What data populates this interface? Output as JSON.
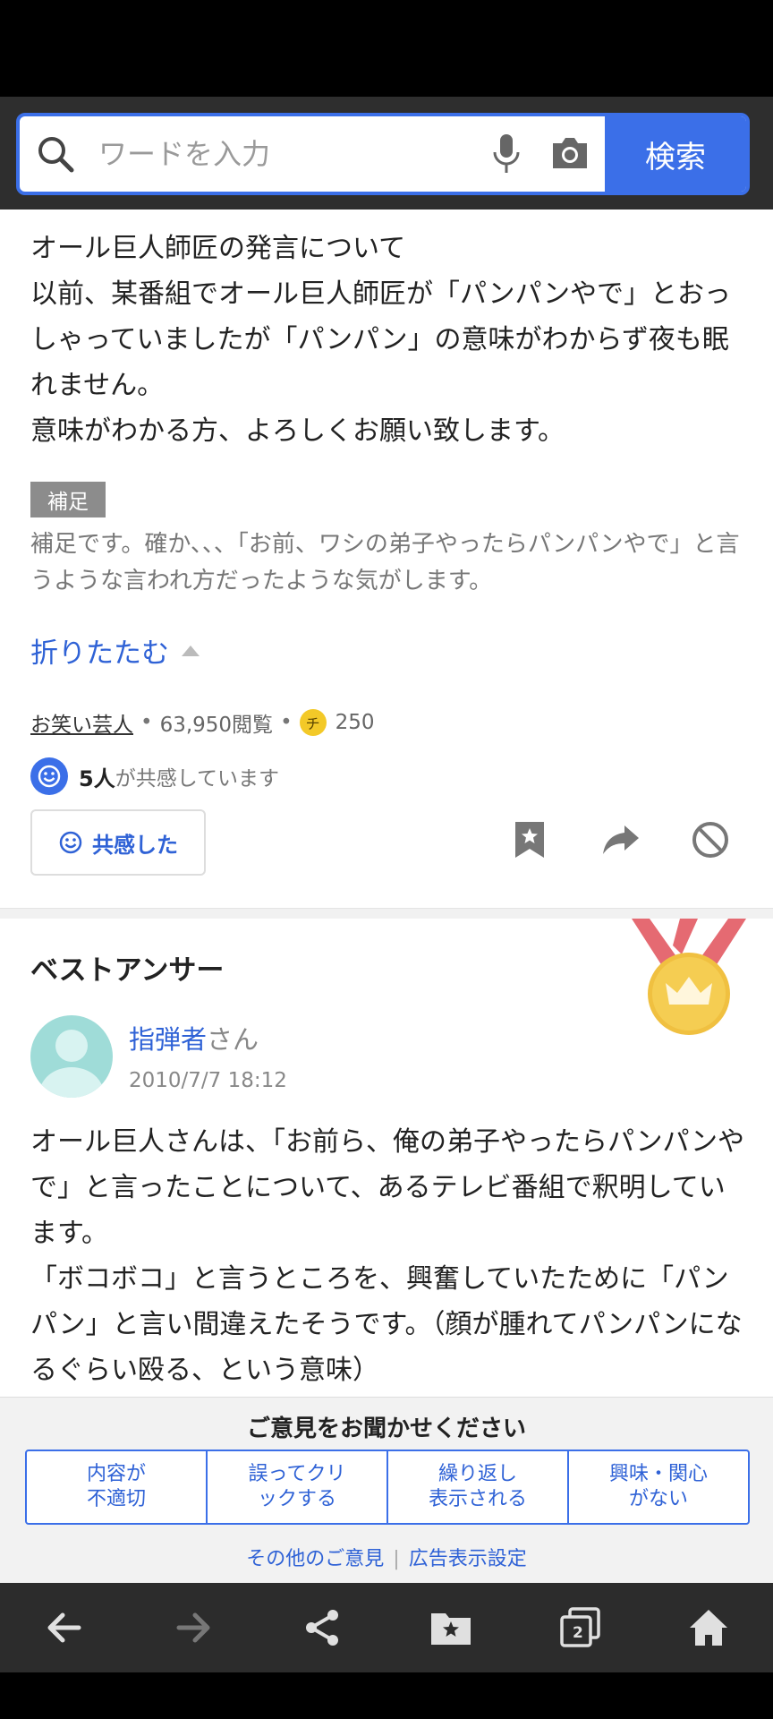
{
  "search": {
    "placeholder": "ワードを入力",
    "button_label": "検索"
  },
  "question": {
    "text": "オール巨人師匠の発言について\n以前、某番組でオール巨人師匠が「パンパンやで」とおっしゃっていましたが「パンパン」の意味がわからず夜も眠れません。\n意味がわかる方、よろしくお願い致します。",
    "supplement_badge": "補足",
    "supplement_text": "補足です。確か、、、「お前、ワシの弟子やったらパンパンやで」と言うような言われ方だったような気がします。",
    "fold_label": "折りたたむ",
    "category": "お笑い芸人",
    "views": "63,950閲覧",
    "coin_label": "チ",
    "coins": "250",
    "empathy_count": "5人",
    "empathy_suffix": "が共感しています",
    "empathy_button": "共感した"
  },
  "best_answer": {
    "title": "ベストアンサー",
    "answerer_name": "指弾者",
    "answerer_suffix": "さん",
    "date": "2010/7/7 18:12",
    "text": "オール巨人さんは、「お前ら、俺の弟子やったらパンパンやで」と言ったことについて、あるテレビ番組で釈明しています。\n「ボコボコ」と言うところを、興奮していたために「パンパン」と言い間違えたそうです。（顔が腫れてパンパンになるぐらい殴る、という意味）"
  },
  "feedback": {
    "title": "ご意見をお聞かせください",
    "buttons": [
      "内容が\n不適切",
      "誤ってクリ\nックする",
      "繰り返し\n表示される",
      "興味・関心\nがない"
    ],
    "other_link": "その他のご意見",
    "ad_settings_link": "広告表示設定"
  },
  "navbar": {
    "tab_count": "2"
  },
  "colors": {
    "accent": "#3b6fe8",
    "link": "#2f62d6",
    "medal_gold": "#f3c94a",
    "ribbon": "#e56a72"
  }
}
